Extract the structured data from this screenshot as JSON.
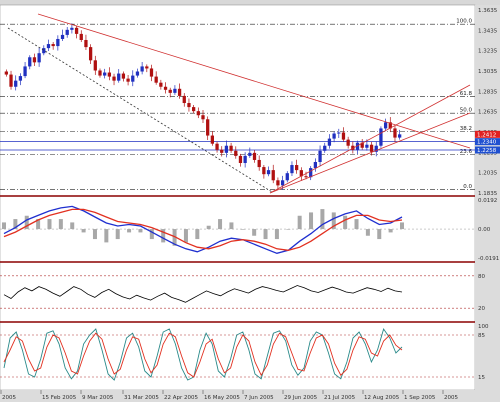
{
  "chart_data": [
    {
      "panel": "price",
      "type": "candlestick",
      "title": "",
      "x_dates": [
        "2005",
        "15 Feb 2005",
        "9 Mar 2005",
        "31 Mar 2005",
        "22 Apr 2005",
        "16 May 2005",
        "7 Jun 2005",
        "29 Jun 2005",
        "21 Jul 2005",
        "12 Aug 2005",
        "1 Sep 2005",
        "2005"
      ],
      "ylim": [
        1.1835,
        1.3635
      ],
      "y_ticks": [
        1.3635,
        1.3435,
        1.3235,
        1.3035,
        1.2835,
        1.2635,
        1.2435,
        1.2235,
        1.2035,
        1.1835
      ],
      "price_labels": {
        "current": "1.2412",
        "blue_line_1": "1.2340",
        "blue_line_2": "1.2258"
      },
      "blue_lines": [
        1.234,
        1.2258
      ],
      "fibonacci": [
        {
          "label": "100.0",
          "value": 1.3495
        },
        {
          "label": "61.8",
          "value": 1.2785
        },
        {
          "label": "50.0",
          "value": 1.262
        },
        {
          "label": "38.2",
          "value": 1.244
        },
        {
          "label": "23.6",
          "value": 1.2215
        },
        {
          "label": "0.0",
          "value": 1.187
        }
      ],
      "series": [
        {
          "type": "close",
          "values": [
            1.3,
            1.288,
            1.294,
            1.2985,
            1.308,
            1.317,
            1.312,
            1.321,
            1.326,
            1.33,
            1.328,
            1.335,
            1.339,
            1.344,
            1.346,
            1.34,
            1.334,
            1.327,
            1.314,
            1.304,
            1.299,
            1.302,
            1.298,
            1.294,
            1.301,
            1.296,
            1.293,
            1.299,
            1.303,
            1.308,
            1.306,
            1.298,
            1.292,
            1.288,
            1.285,
            1.282,
            1.286,
            1.279,
            1.272,
            1.268,
            1.264,
            1.26,
            1.256,
            1.24,
            1.232,
            1.226,
            1.223,
            1.23,
            1.225,
            1.22,
            1.213,
            1.22,
            1.223,
            1.216,
            1.209,
            1.202,
            1.206,
            1.196,
            1.191,
            1.196,
            1.203,
            1.211,
            1.206,
            1.2,
            1.199,
            1.208,
            1.214,
            1.225,
            1.23,
            1.237,
            1.242,
            1.243,
            1.236,
            1.23,
            1.226,
            1.233,
            1.228,
            1.231,
            1.224,
            1.23,
            1.247,
            1.253,
            1.247,
            1.238,
            1.2412
          ]
        }
      ]
    },
    {
      "panel": "macd",
      "type": "line",
      "ylim": [
        -0.0191,
        0.0192
      ],
      "y_ticks": [
        "0.0192",
        "0.00",
        "-0.0191"
      ],
      "series": [
        {
          "name": "MACD",
          "color": "#1f2fcf",
          "values": [
            -0.003,
            0.001,
            0.006,
            0.009,
            0.012,
            0.014,
            0.015,
            0.012,
            0.008,
            0.004,
            0.002,
            0.003,
            0.002,
            -0.002,
            -0.006,
            -0.01,
            -0.013,
            -0.015,
            -0.012,
            -0.008,
            -0.006,
            -0.007,
            -0.01,
            -0.013,
            -0.016,
            -0.014,
            -0.008,
            -0.003,
            0.003,
            0.007,
            0.01,
            0.012,
            0.007,
            0.003,
            0.004,
            0.008
          ]
        },
        {
          "name": "Signal",
          "color": "#e23020",
          "values": [
            -0.005,
            -0.002,
            0.002,
            0.006,
            0.009,
            0.011,
            0.013,
            0.013,
            0.011,
            0.008,
            0.005,
            0.004,
            0.003,
            0.001,
            -0.002,
            -0.005,
            -0.009,
            -0.012,
            -0.013,
            -0.011,
            -0.008,
            -0.007,
            -0.008,
            -0.01,
            -0.013,
            -0.014,
            -0.012,
            -0.008,
            -0.003,
            0.002,
            0.006,
            0.009,
            0.009,
            0.006,
            0.005,
            0.006
          ]
        }
      ]
    },
    {
      "panel": "rsi",
      "type": "line",
      "ylim": [
        0,
        100
      ],
      "y_ticks": [
        "80",
        "20"
      ],
      "levels": [
        80,
        20
      ],
      "series": [
        {
          "name": "RSI",
          "color": "#000000",
          "values": [
            45,
            38,
            50,
            58,
            52,
            60,
            55,
            48,
            42,
            51,
            60,
            55,
            46,
            40,
            49,
            55,
            47,
            41,
            37,
            44,
            39,
            35,
            42,
            48,
            40,
            36,
            31,
            38,
            45,
            52,
            47,
            43,
            50,
            56,
            52,
            48,
            55,
            60,
            57,
            53,
            50,
            56,
            62,
            58,
            52,
            49,
            54,
            59,
            55,
            50,
            48,
            53,
            58,
            55,
            51,
            57,
            52,
            50
          ]
        }
      ]
    },
    {
      "panel": "stochastic",
      "type": "line",
      "ylim": [
        0,
        100
      ],
      "y_ticks": [
        "100",
        "85",
        "15"
      ],
      "levels": [
        85,
        15
      ],
      "series": [
        {
          "name": "%K",
          "color": "#2a8a8a",
          "values": [
            30,
            80,
            90,
            60,
            20,
            15,
            45,
            88,
            92,
            70,
            30,
            12,
            25,
            70,
            85,
            95,
            60,
            20,
            10,
            40,
            80,
            88,
            65,
            25,
            15,
            50,
            90,
            95,
            70,
            30,
            10,
            15,
            60,
            88,
            70,
            25,
            15,
            45,
            85,
            90,
            60,
            20,
            12,
            50,
            88,
            92,
            75,
            35,
            18,
            30,
            75,
            90,
            85,
            55,
            20,
            12,
            40,
            80,
            90,
            70,
            40,
            60,
            95,
            80,
            55,
            65
          ]
        },
        {
          "name": "%D",
          "color": "#e23020",
          "values": [
            40,
            60,
            82,
            75,
            45,
            25,
            30,
            65,
            85,
            80,
            55,
            25,
            20,
            50,
            75,
            88,
            78,
            45,
            20,
            28,
            60,
            82,
            78,
            45,
            22,
            35,
            70,
            88,
            82,
            50,
            22,
            15,
            40,
            70,
            78,
            45,
            22,
            30,
            65,
            85,
            75,
            40,
            18,
            35,
            70,
            88,
            82,
            55,
            28,
            25,
            55,
            80,
            85,
            70,
            38,
            18,
            28,
            60,
            82,
            78,
            55,
            50,
            75,
            85,
            68,
            60
          ]
        }
      ]
    }
  ]
}
